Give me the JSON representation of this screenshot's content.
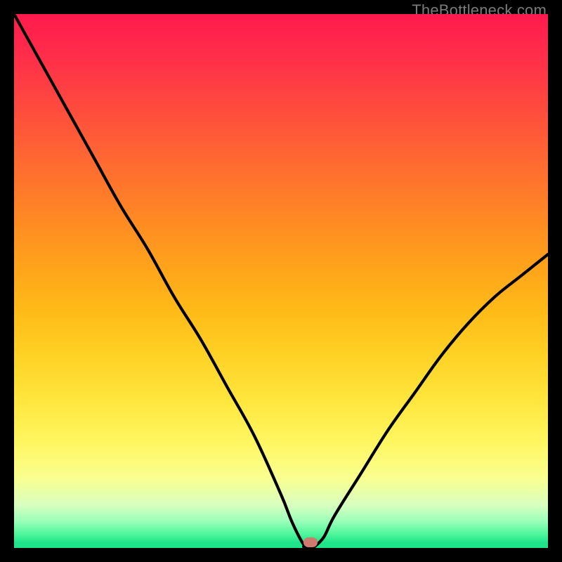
{
  "watermark": "TheBottleneck.com",
  "gradient_colors": {
    "top": "#ff1a4d",
    "mid_upper": "#ff8e22",
    "mid": "#ffe53c",
    "lower": "#9affb8",
    "bottom": "#1fe48a"
  },
  "marker": {
    "x_pct": 55.5,
    "y_pct": 99.0,
    "color": "#cf7a6f"
  },
  "chart_data": {
    "type": "line",
    "title": "",
    "xlabel": "",
    "ylabel": "",
    "xlim": [
      0,
      100
    ],
    "ylim": [
      0,
      100
    ],
    "x": [
      0,
      5,
      10,
      15,
      20,
      25,
      30,
      35,
      40,
      45,
      50,
      52,
      54,
      55,
      56,
      58,
      60,
      65,
      70,
      75,
      80,
      85,
      90,
      95,
      100
    ],
    "values": [
      100,
      91,
      82,
      73,
      64,
      56,
      47,
      39,
      30,
      21,
      10,
      5,
      1,
      0,
      0,
      2,
      6,
      14,
      22,
      29,
      36,
      42,
      47,
      51,
      55
    ],
    "annotations": [
      {
        "text": "TheBottleneck.com",
        "position": "top-right"
      }
    ],
    "minimum_point": {
      "x": 55,
      "y": 0
    }
  }
}
